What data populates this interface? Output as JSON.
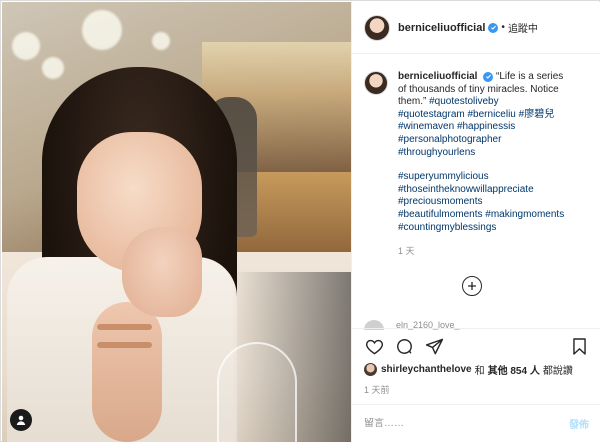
{
  "post": {
    "username": "berniceliuofficial",
    "dot": "•",
    "follow_status": "追蹤中",
    "caption_quote": "“Life is a series of thousands of tiny miracles. Notice them.”",
    "hashtags_line1": "#quotestoliveby",
    "hashtags_line2a": "#quotestagram",
    "hashtags_line2b": "#berniceliu",
    "hashtags_line2c": "#廖碧兒",
    "hashtags_line3a": "#winemaven",
    "hashtags_line3b": "#happinessis",
    "hashtags_line4": "#personalphotographer",
    "hashtags_line5": "#throughyourlens",
    "hashtags_line6": "#superyummylicious",
    "hashtags_line7": "#thoseintheknowwillappreciate",
    "hashtags_line8": "#preciousmoments",
    "hashtags_line9a": "#beautifulmoments",
    "hashtags_line9b": "#makingmoments",
    "hashtags_line10": "#countingmyblessings",
    "caption_age": "1 天",
    "peek_comment": "eln_2160_love_",
    "liked_by_user": "shirleychanthelove",
    "liked_and": "和",
    "liked_others": "其他 854 人",
    "liked_suffix": "都說讚",
    "posted_ago": "1 天前",
    "comment_placeholder": "留言……",
    "post_button": "發佈"
  },
  "icons": {
    "like": "heart-icon",
    "comment": "comment-icon",
    "share": "share-icon",
    "save": "bookmark-icon",
    "more": "plus-circle-icon",
    "verified": "verified-badge-icon",
    "tagged": "user-tag-icon"
  },
  "colors": {
    "verified": "#3897f0",
    "hashtag": "#00376b",
    "muted": "#8e8e8e"
  }
}
